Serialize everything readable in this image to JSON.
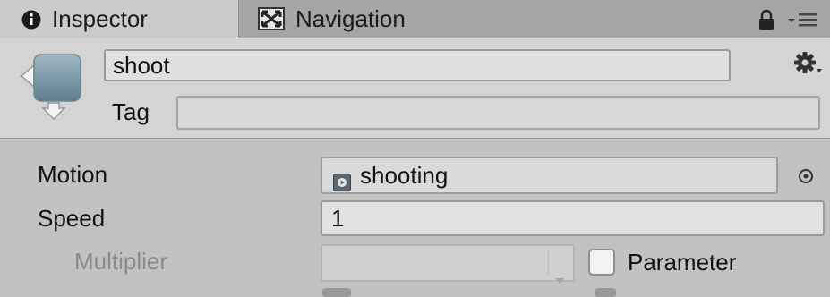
{
  "tabs": {
    "inspector_label": "Inspector",
    "navigation_label": "Navigation"
  },
  "state": {
    "name": "shoot",
    "tag_label": "Tag",
    "tag_value": ""
  },
  "properties": {
    "motion_label": "Motion",
    "motion_value": "shooting",
    "speed_label": "Speed",
    "speed_value": "1",
    "multiplier_label": "Multiplier",
    "multiplier_value": "",
    "parameter_label": "Parameter",
    "parameter_checked": false
  },
  "icons": {
    "inspector": "info-icon",
    "navigation": "navigation-icon",
    "lock": "lock-icon",
    "menu": "menu-icon",
    "state": "state-icon",
    "gear": "gear-icon",
    "clip": "animation-clip-icon",
    "picker": "object-picker-icon",
    "dropdown": "chevron-down-icon"
  },
  "colors": {
    "panel_bg": "#c2c2c2",
    "header_bg": "#d4d4d4",
    "tab_bar_bg": "#a5a5a5",
    "active_tab_bg": "#cbcbcb",
    "disabled_text": "#8a8a8a"
  }
}
